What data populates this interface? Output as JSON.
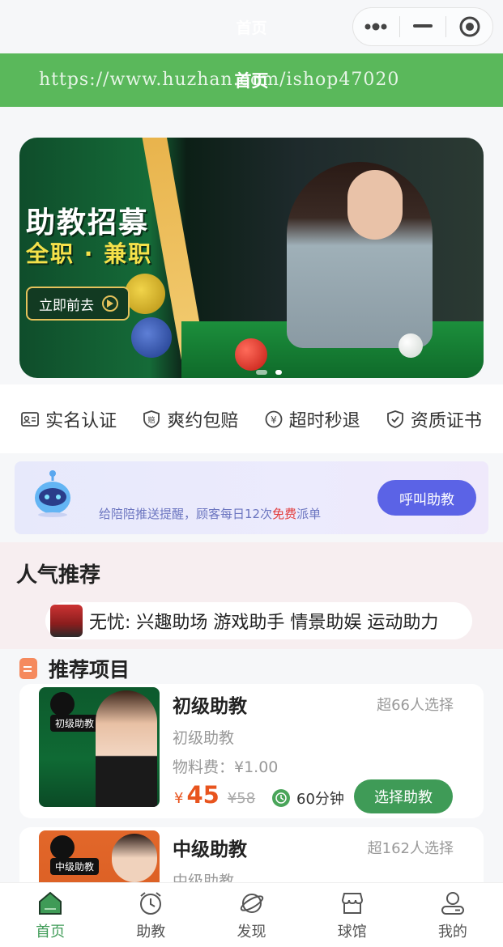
{
  "window": {
    "title": "首页"
  },
  "watermark": {
    "url": "https://www.huzhan.com/ishop47020",
    "title": "首页"
  },
  "colors": {
    "primary_green": "#5ab85b",
    "button_green": "#3f9b57",
    "accent_orange": "#e8541e",
    "call_button": "#5b63e6"
  },
  "banner": {
    "headline": "助教招募",
    "subline": "全职 · 兼职",
    "cta": "立即前去",
    "slides": 2,
    "active_slide": 2
  },
  "guarantees": [
    {
      "icon": "id-card-icon",
      "label": "实名认证"
    },
    {
      "icon": "shield-pay-icon",
      "label": "爽约包赔"
    },
    {
      "icon": "yen-coin-icon",
      "label": "超时秒退"
    },
    {
      "icon": "shield-check-icon",
      "label": "资质证书"
    }
  ],
  "notify": {
    "text_before": "给陪陪推送提醒，顾客每日12次",
    "text_highlight": "免费",
    "text_after": "派单",
    "button": "呼叫助教"
  },
  "popular": {
    "title": "人气推荐",
    "marquee": "无忧: 兴趣助场 游戏助手 情景助娱 运动助力"
  },
  "section": {
    "title": "推荐项目"
  },
  "items": [
    {
      "name": "初级助教",
      "badge": "初级助教",
      "selected": "超66人选择",
      "subtitle": "初级助教",
      "fee": "物料费：¥1.00",
      "currency": "¥",
      "price": "45",
      "old_price": "¥58",
      "duration": "60分钟",
      "button": "选择助教"
    },
    {
      "name": "中级助教",
      "badge": "中级助教",
      "selected": "超162人选择",
      "subtitle": "中级助教"
    }
  ],
  "tabs": [
    {
      "label": "首页",
      "icon": "home-icon",
      "active": true
    },
    {
      "label": "助教",
      "icon": "alarm-clock-icon",
      "active": false
    },
    {
      "label": "发现",
      "icon": "planet-icon",
      "active": false
    },
    {
      "label": "球馆",
      "icon": "store-icon",
      "active": false
    },
    {
      "label": "我的",
      "icon": "user-icon",
      "active": false
    }
  ]
}
